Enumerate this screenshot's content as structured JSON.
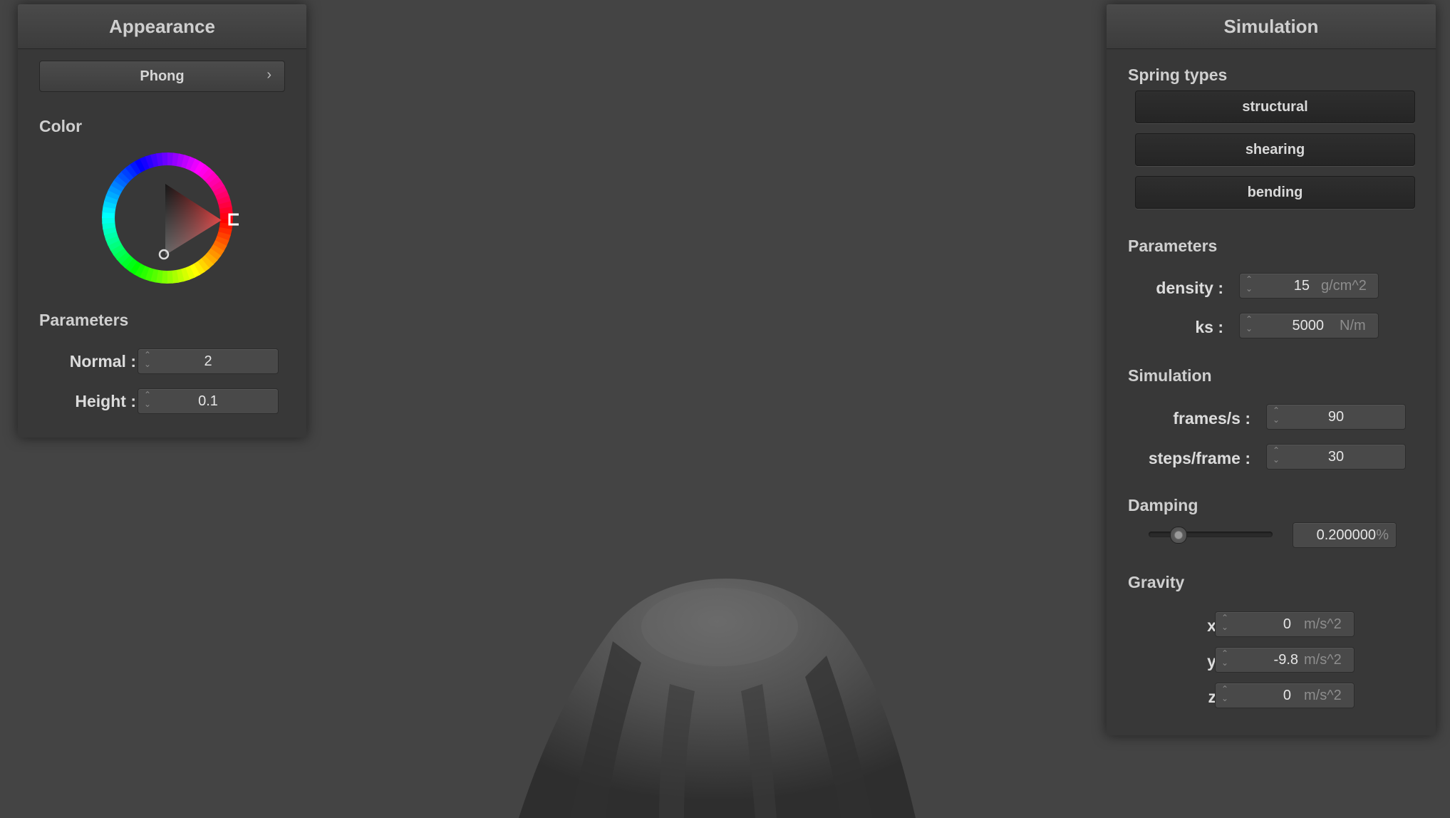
{
  "appearance": {
    "title": "Appearance",
    "shader_button": "Phong",
    "chevron": "›",
    "color_label": "Color",
    "params_label": "Parameters",
    "normal_label": "Normal :",
    "normal_value": "2",
    "height_label": "Height :",
    "height_value": "0.1",
    "selected_color": "#e02020"
  },
  "simulation": {
    "title": "Simulation",
    "spring_types_label": "Spring types",
    "spring_buttons": [
      "structural",
      "shearing",
      "bending"
    ],
    "params_label": "Parameters",
    "density_label": "density :",
    "density_value": "15",
    "density_unit": "g/cm^2",
    "ks_label": "ks :",
    "ks_value": "5000",
    "ks_unit": "N/m",
    "sim_label": "Simulation",
    "fps_label": "frames/s :",
    "fps_value": "90",
    "steps_label": "steps/frame :",
    "steps_value": "30",
    "damping_label": "Damping",
    "damping_value": "0.200000",
    "damping_unit": "%",
    "damping_slider_fraction": 0.2,
    "gravity_label": "Gravity",
    "gx_label": "x :",
    "gx_value": "0",
    "gy_label": "y :",
    "gy_value": "-9.8",
    "gz_label": "z :",
    "gz_value": "0",
    "g_unit": "m/s^2"
  },
  "colors": {
    "background": "#444444",
    "panel": "#383838",
    "cloth": "#5a5a5a"
  }
}
